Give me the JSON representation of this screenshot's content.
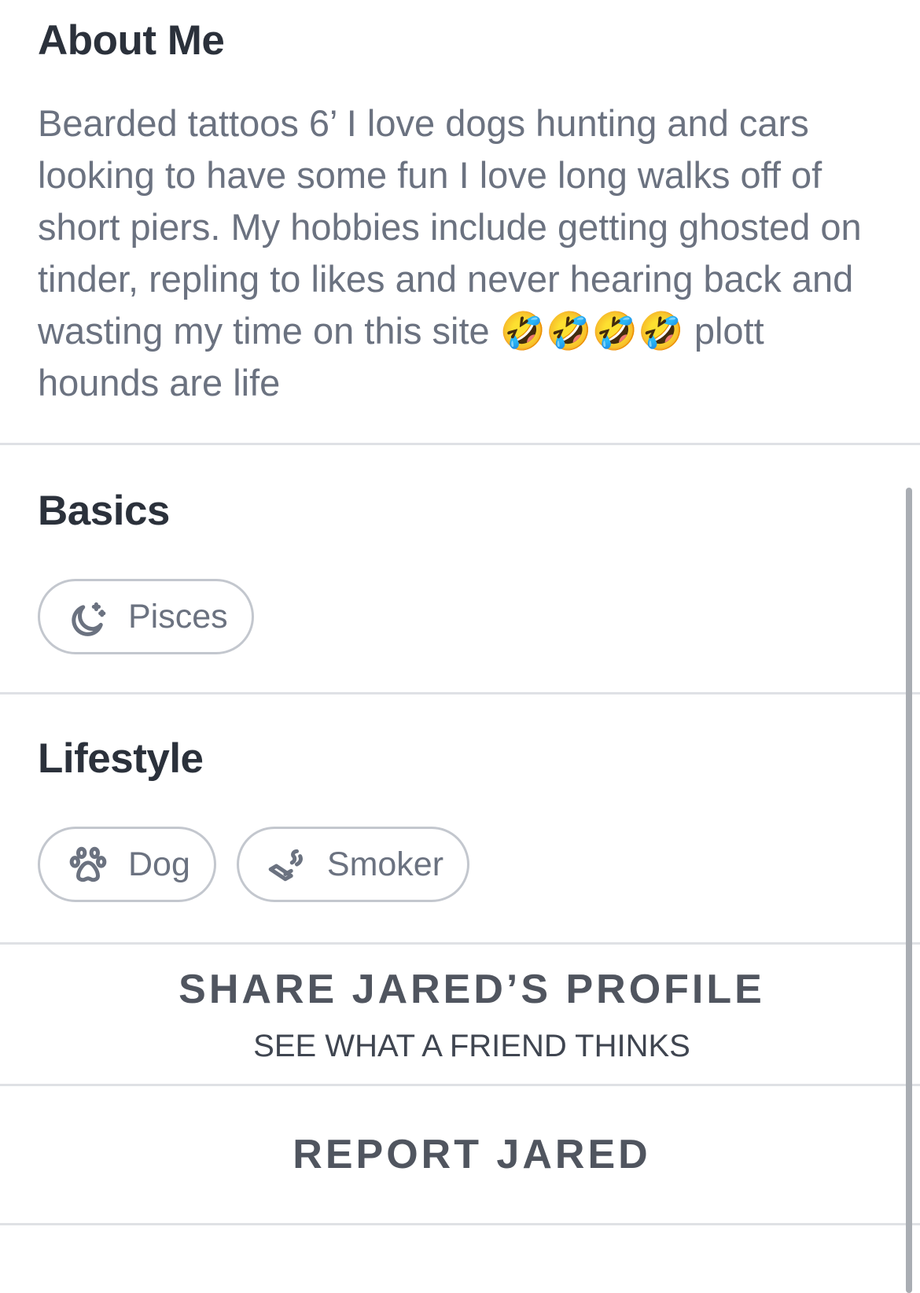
{
  "about": {
    "title": "About Me",
    "text": "Bearded tattoos 6’ I love dogs hunting and cars looking to have some fun I love long walks off of short piers. My hobbies include getting ghosted on tinder, repling to likes and never hearing back and wasting my time on this site 🤣🤣🤣🤣 plott hounds are life"
  },
  "basics": {
    "title": "Basics",
    "chips": [
      {
        "icon": "moon-stars-icon",
        "label": "Pisces"
      }
    ]
  },
  "lifestyle": {
    "title": "Lifestyle",
    "chips": [
      {
        "icon": "paw-icon",
        "label": "Dog"
      },
      {
        "icon": "cigarette-icon",
        "label": "Smoker"
      }
    ]
  },
  "share": {
    "title": "SHARE JARED’S PROFILE",
    "subtitle": "SEE WHAT A FRIEND THINKS"
  },
  "report": {
    "title": "REPORT JARED"
  }
}
